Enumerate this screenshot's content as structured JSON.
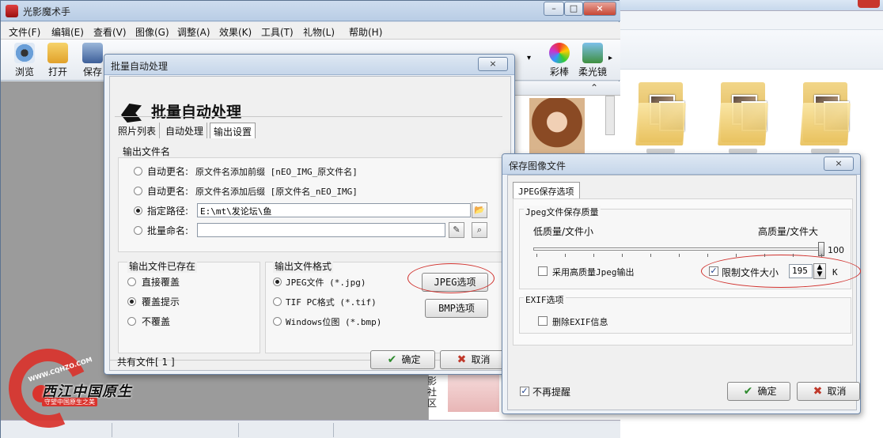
{
  "app": {
    "title": "光影魔术手",
    "menu": [
      "文件(F)",
      "编辑(E)",
      "查看(V)",
      "图像(G)",
      "调整(A)",
      "效果(K)",
      "工具(T)",
      "礼物(L)",
      "帮助(H)"
    ],
    "toolbar": [
      "浏览",
      "打开",
      "保存",
      "彩棒",
      "柔光镜"
    ],
    "side_text": "影社区"
  },
  "watermark": {
    "site": "WWW.CQHZO.COM",
    "name": "西江中国原生",
    "slogan": "守望中国原生之美"
  },
  "batch": {
    "title": "批量自动处理",
    "heading": "批量自动处理",
    "tabs": [
      "照片列表",
      "自动处理",
      "输出设置"
    ],
    "out_name_group": "输出文件名",
    "options": [
      {
        "label": "自动更名:",
        "desc": "原文件名添加前缀 [nEO_IMG_原文件名]"
      },
      {
        "label": "自动更名:",
        "desc": "原文件名添加后缀 [原文件名_nEO_IMG]"
      }
    ],
    "path_label": "指定路径:",
    "path_value": "E:\\mt\\发论坛\\鱼",
    "batch_name_label": "批量命名:",
    "exists_group": "输出文件已存在",
    "exists_options": [
      "直接覆盖",
      "覆盖提示",
      "不覆盖"
    ],
    "format_group": "输出文件格式",
    "formats": [
      "JPEG文件 (*.jpg)",
      "TIF PC格式 (*.tif)",
      "Windows位图 (*.bmp)"
    ],
    "jpeg_options_btn": "JPEG选项",
    "bmp_options_btn": "BMP选项",
    "total_label": "共有文件[ 1 ]",
    "ok": "确定",
    "cancel": "取消"
  },
  "save": {
    "title": "保存图像文件",
    "tab": "JPEG保存选项",
    "quality_group": "Jpeg文件保存质量",
    "low_label": "低质量/文件小",
    "high_label": "高质量/文件大",
    "quality_value": "100",
    "quality_fraction": 1.0,
    "high_quality_output": "采用高质量Jpeg输出",
    "limit_size_label": "限制文件大小",
    "limit_size_value": "195",
    "limit_unit": "K",
    "exif_group": "EXIF选项",
    "delete_exif": "删除EXIF信息",
    "no_remind": "不再提醒",
    "ok": "确定",
    "cancel": "取消"
  }
}
